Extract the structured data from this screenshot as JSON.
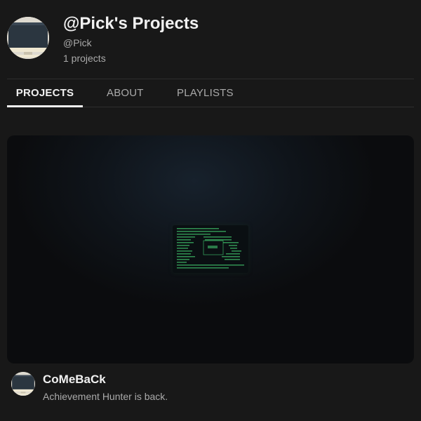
{
  "channel": {
    "title": "@Pick's Projects",
    "handle": "@Pick",
    "project_count": "1 projects",
    "avatar_icon": "computer-monitor-icon"
  },
  "tabs": [
    {
      "label": "PROJECTS",
      "active": true
    },
    {
      "label": "ABOUT",
      "active": false
    },
    {
      "label": "PLAYLISTS",
      "active": false
    }
  ],
  "project": {
    "title": "CoMeBaCk",
    "description": "Achievement Hunter is back.",
    "thumbnail_icon": "terminal-screen-icon",
    "avatar_icon": "computer-monitor-icon"
  },
  "colors": {
    "background": "#181818",
    "text_primary": "#f1f1f1",
    "text_secondary": "#aaaaaa",
    "terminal_green": "#3fbf6a"
  }
}
